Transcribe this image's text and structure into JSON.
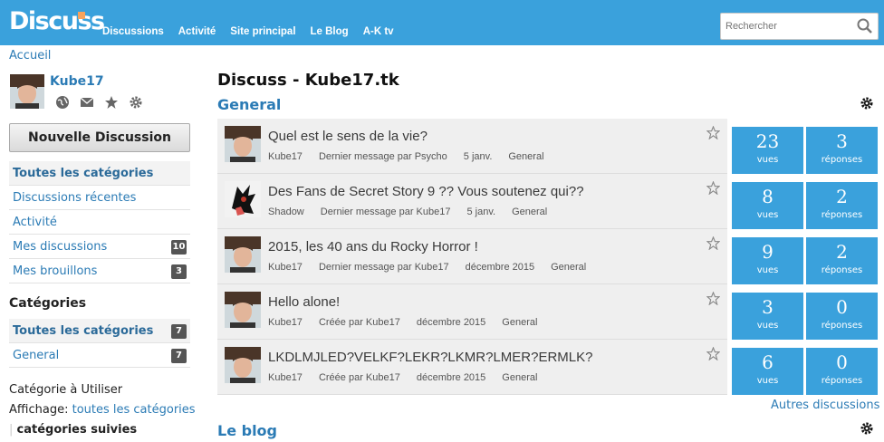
{
  "header": {
    "logo": "Discuss",
    "nav": [
      "Discussions",
      "Activité",
      "Site principal",
      "Le Blog",
      "A-K tv"
    ],
    "search_placeholder": "Rechercher"
  },
  "breadcrumb": "Accueil",
  "profile": {
    "name": "Kube17"
  },
  "new_discussion_label": "Nouvelle Discussion",
  "side_items": [
    {
      "label": "Toutes les catégories",
      "count": ""
    },
    {
      "label": "Discussions récentes",
      "count": ""
    },
    {
      "label": "Activité",
      "count": ""
    },
    {
      "label": "Mes discussions",
      "count": "10"
    },
    {
      "label": "Mes brouillons",
      "count": "3"
    }
  ],
  "categories": {
    "title": "Catégories",
    "items": [
      {
        "label": "Toutes les catégories",
        "count": "7"
      },
      {
        "label": "General",
        "count": "7"
      }
    ]
  },
  "footer_left": {
    "line1": "Catégorie à Utiliser",
    "affichage_label": "Affichage:",
    "all_link": "toutes les catégories",
    "followed": "catégories suivies"
  },
  "main": {
    "title": "Discuss - Kube17.tk",
    "section": "General",
    "more_link": "Autres discussions",
    "blog_title": "Le blog"
  },
  "discussions": [
    {
      "title": "Quel est le sens de la vie?",
      "author": "Kube17",
      "info": "Dernier message par Psycho",
      "date": "5 janv.",
      "category": "General",
      "views": "23",
      "views_label": "vues",
      "replies": "3",
      "replies_label": "réponses"
    },
    {
      "title": "Des Fans de Secret Story 9 ?? Vous soutenez qui??",
      "author": "Shadow",
      "info": "Dernier message par Kube17",
      "date": "5 janv.",
      "category": "General",
      "views": "8",
      "views_label": "vues",
      "replies": "2",
      "replies_label": "réponses"
    },
    {
      "title": "2015, les 40 ans du Rocky Horror !",
      "author": "Kube17",
      "info": "Dernier message par Kube17",
      "date": "décembre 2015",
      "category": "General",
      "views": "9",
      "views_label": "vues",
      "replies": "2",
      "replies_label": "réponses"
    },
    {
      "title": "Hello alone!",
      "author": "Kube17",
      "info": "Créée par Kube17",
      "date": "décembre 2015",
      "category": "General",
      "views": "3",
      "views_label": "vues",
      "replies": "0",
      "replies_label": "réponses"
    },
    {
      "title": "LKDLMJLED?VELKF?LEKR?LKMR?LMER?ERMLK?",
      "author": "Kube17",
      "info": "Créée par Kube17",
      "date": "décembre 2015",
      "category": "General",
      "views": "6",
      "views_label": "vues",
      "replies": "0",
      "replies_label": "réponses"
    }
  ]
}
